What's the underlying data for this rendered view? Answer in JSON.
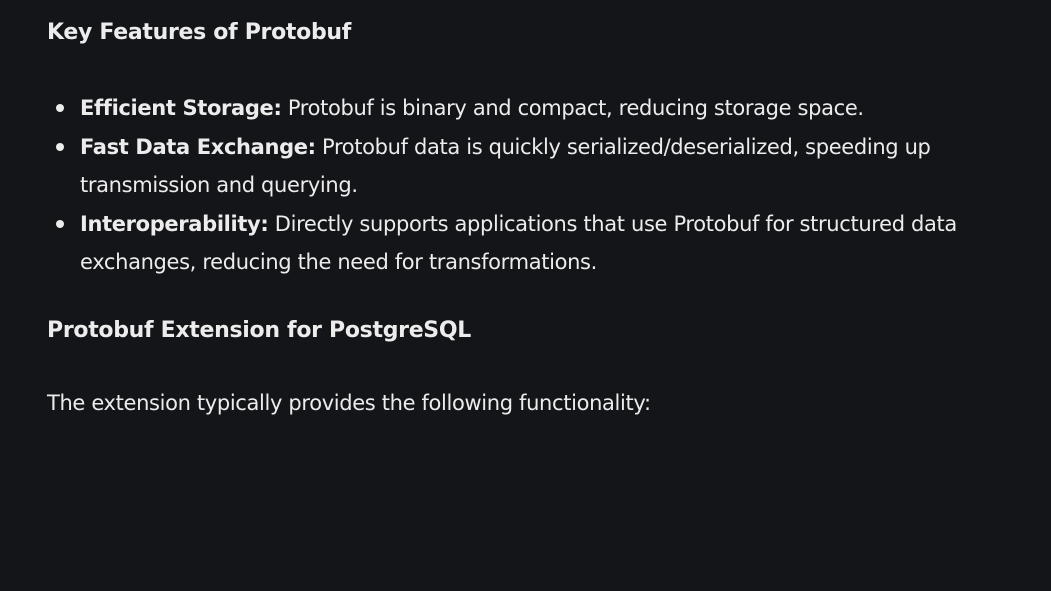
{
  "section_features": {
    "heading": "Key Features of Protobuf",
    "items": [
      {
        "term": "Efficient Storage:",
        "description": "Protobuf is binary and compact, reducing storage space."
      },
      {
        "term": "Fast Data Exchange:",
        "description": "Protobuf data is quickly serialized/deserialized, speeding up transmission and querying."
      },
      {
        "term": "Interoperability:",
        "description": "Directly supports applications that use Protobuf for structured data exchanges, reducing the need for transformations."
      }
    ]
  },
  "section_extension": {
    "heading": "Protobuf Extension for PostgreSQL",
    "intro": "The extension typically provides the following functionality:"
  }
}
